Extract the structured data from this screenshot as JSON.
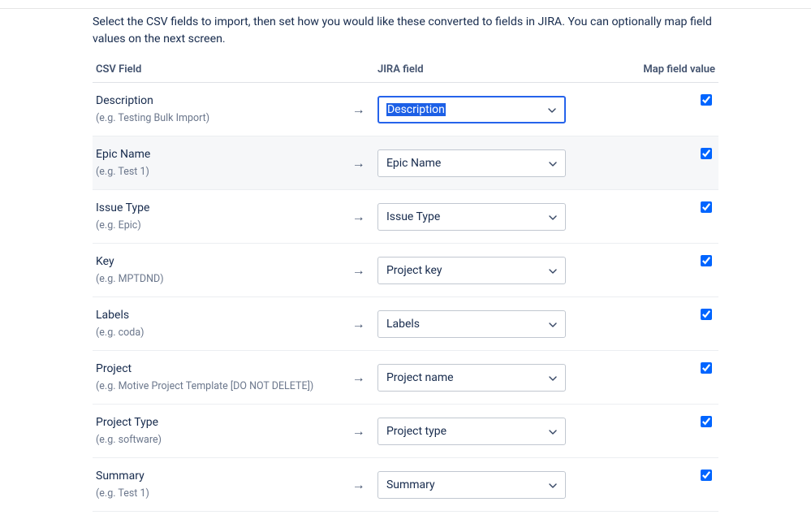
{
  "intro": "Select the CSV fields to import, then set how you would like these converted to fields in JIRA. You can optionally map field values on the next screen.",
  "columns": {
    "csv": "CSV Field",
    "jira": "JIRA field",
    "map": "Map field value"
  },
  "example_prefix": "(e.g. ",
  "example_suffix": ")",
  "rows": [
    {
      "name": "Description",
      "example": "Testing Bulk Import",
      "jira": "Description",
      "focused": true,
      "checked": true,
      "alt": false
    },
    {
      "name": "Epic Name",
      "example": "Test 1",
      "jira": "Epic Name",
      "focused": false,
      "checked": true,
      "alt": true
    },
    {
      "name": "Issue Type",
      "example": "Epic",
      "jira": "Issue Type",
      "focused": false,
      "checked": true,
      "alt": false
    },
    {
      "name": "Key",
      "example": "MPTDND",
      "jira": "Project key",
      "focused": false,
      "checked": true,
      "alt": false
    },
    {
      "name": "Labels",
      "example": "coda",
      "jira": "Labels",
      "focused": false,
      "checked": true,
      "alt": false
    },
    {
      "name": "Project",
      "example": "Motive Project Template [DO NOT DELETE]",
      "jira": "Project name",
      "focused": false,
      "checked": true,
      "alt": false
    },
    {
      "name": "Project Type",
      "example": "software",
      "jira": "Project type",
      "focused": false,
      "checked": true,
      "alt": false
    },
    {
      "name": "Summary",
      "example": "Test 1",
      "jira": "Summary",
      "focused": false,
      "checked": true,
      "alt": false
    }
  ]
}
